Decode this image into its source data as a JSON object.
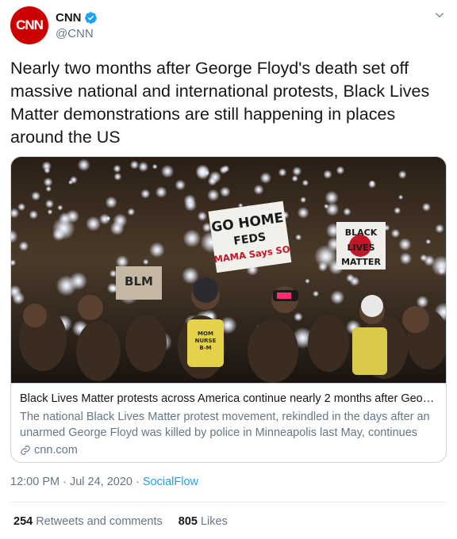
{
  "account": {
    "avatar_text": "CNN",
    "display_name": "CNN",
    "handle": "@CNN",
    "brand_color": "#cc0000",
    "verified_color": "#1da1f2"
  },
  "tweet": {
    "text": "Nearly two months after George Floyd's death set off massive national and international protests, Black Lives Matter demonstrations are still happening in places around the US"
  },
  "card": {
    "title": "Black Lives Matter protests across America continue nearly 2 months after Georg...",
    "description": "The national Black Lives Matter protest movement, rekindled in the days after an unarmed George Floyd was killed by police in Minneapolis last May, continues to...",
    "domain": "cnn.com",
    "photo_signs": {
      "go_home_line1": "GO HOME",
      "go_home_line2": "FEDS",
      "go_home_line3": "MAMA Says SO",
      "blm": "BLM",
      "black_lives_line1": "BLACK",
      "black_lives_line2": "LIVES",
      "black_lives_line3": "MATTER",
      "shirt_line1": "MOM",
      "shirt_line2": "NURSE",
      "shirt_line3": "B-M"
    }
  },
  "meta": {
    "time": "12:00 PM",
    "separator1": " · ",
    "date": "Jul 24, 2020",
    "separator2": " · ",
    "source": "SocialFlow"
  },
  "stats": {
    "retweets_count": "254",
    "retweets_label": "Retweets and comments",
    "likes_count": "805",
    "likes_label": "Likes"
  }
}
